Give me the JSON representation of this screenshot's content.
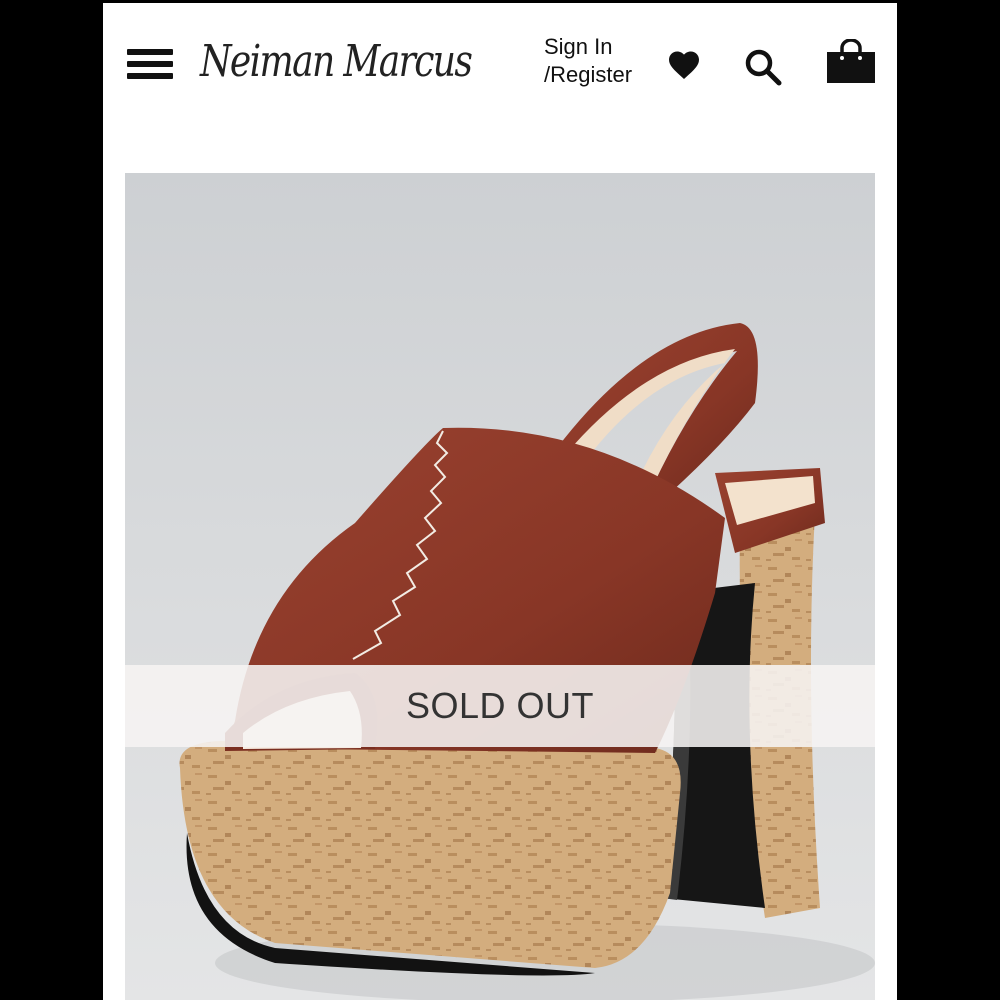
{
  "header": {
    "brand_logo": "Neiman Marcus",
    "sign_in_line1": "Sign In",
    "sign_in_line2": "/Register",
    "icons": [
      "menu-icon",
      "heart-icon",
      "search-icon",
      "shopping-bag-icon"
    ]
  },
  "product": {
    "status_label": "SOLD OUT"
  },
  "colors": {
    "background": "#ffffff",
    "frame": "#000000",
    "leather": "#8c3b2b",
    "cork": "#d3ad7e",
    "heel": "#1a1a1a"
  }
}
